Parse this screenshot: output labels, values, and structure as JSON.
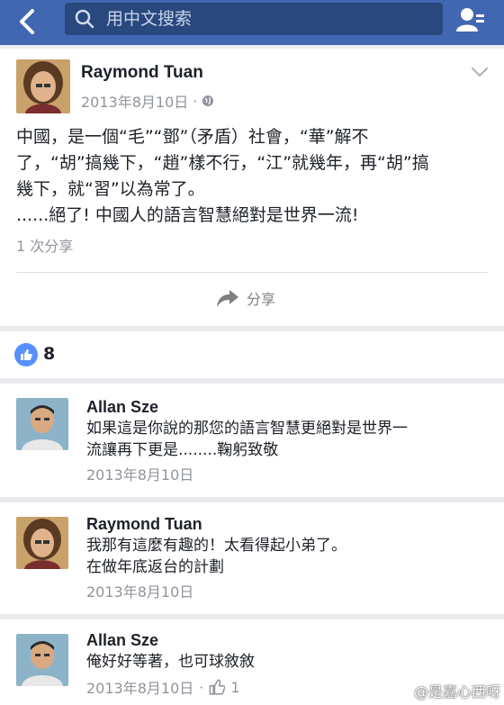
{
  "topbar": {
    "search_placeholder": "用中文搜索"
  },
  "post": {
    "author": "Raymond Tuan",
    "date": "2013年8月10日",
    "lines": [
      "中國，是一個“毛”“鄧”（矛盾）社會，“華”解不",
      "了，“胡”搞幾下，“趙”樣不行，“江”就幾年，再“胡”搞",
      "幾下，就“習”以為常了。",
      " ......絕了! 中國人的語言智慧絕對是世界一流!"
    ],
    "share_count": "1 次分享",
    "share_label": "分享"
  },
  "likes": {
    "count": "8"
  },
  "comments": [
    {
      "name": "Allan Sze",
      "lines": [
        "如果這是你說的那您的語言智慧更絕對是世界一",
        "流讓再下更是........鞠躬致敬"
      ],
      "date": "2013年8月10日"
    },
    {
      "name": "Raymond Tuan",
      "lines": [
        "我那有這麼有趣的！太看得起小弟了。",
        "在做年底返台的計劃"
      ],
      "date": "2013年8月10日"
    },
    {
      "name": "Allan Sze",
      "lines": [
        "俺好好等著，也可球敘敘"
      ],
      "date": "2013年8月10日",
      "likes": "1"
    }
  ],
  "watermark": "@是嘉心西呀",
  "colors": {
    "brand": "#4267b2",
    "search_bg": "#29487d",
    "like_blue": "#5890ff"
  }
}
